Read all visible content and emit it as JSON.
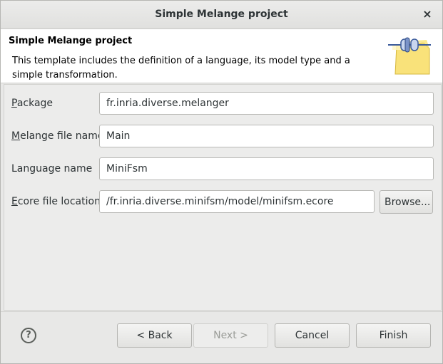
{
  "window": {
    "title": "Simple Melange project",
    "close_glyph": "×"
  },
  "banner": {
    "title": "Simple Melange project",
    "description": "This template includes the definition of a language, its model type and a simple transformation.",
    "icon": "plugin-wizard-icon"
  },
  "form": {
    "package": {
      "label_mnemonic": "P",
      "label_rest": "ackage",
      "value": "fr.inria.diverse.melanger"
    },
    "melange_file": {
      "label_mnemonic": "M",
      "label_rest": "elange file name",
      "value": "Main"
    },
    "language": {
      "label": "Language name",
      "value": "MiniFsm"
    },
    "ecore": {
      "label_mnemonic": "E",
      "label_rest": "core file location",
      "value": "/fr.inria.diverse.minifsm/model/minifsm.ecore"
    },
    "browse_label": "Browse..."
  },
  "footer": {
    "help_glyph": "?",
    "back_label": "< Back",
    "next_label": "Next >",
    "cancel_label": "Cancel",
    "finish_label": "Finish"
  },
  "colors": {
    "window_bg": "#e8e8e7",
    "banner_bg": "#ffffff",
    "disabled_text": "#9a9c97"
  }
}
